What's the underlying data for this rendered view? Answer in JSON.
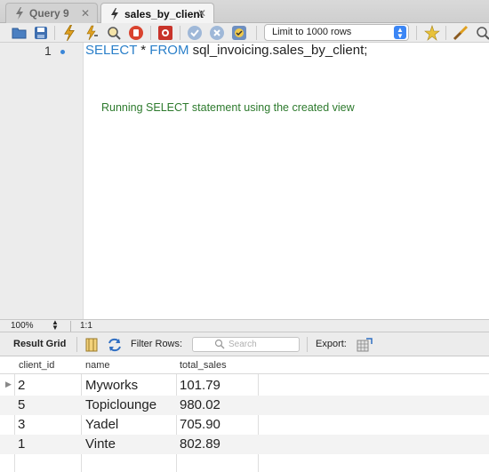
{
  "tabs": [
    {
      "label": "Query 9",
      "active": false
    },
    {
      "label": "sales_by_client",
      "active": true
    }
  ],
  "toolbar": {
    "limit_value": "Limit to 1000 rows"
  },
  "editor": {
    "line_number": "1",
    "code_keyword_select": "SELECT",
    "code_star": " * ",
    "code_keyword_from": "FROM",
    "code_rest": " sql_invoicing.sales_by_client;",
    "annotation": "Running SELECT statement using the created view"
  },
  "statusbar": {
    "zoom": "100%",
    "position": "1:1"
  },
  "results": {
    "label": "Result Grid",
    "filter_label": "Filter Rows:",
    "search_placeholder": "Search",
    "export_label": "Export:",
    "columns": [
      "client_id",
      "name",
      "total_sales"
    ],
    "rows": [
      [
        "2",
        "Myworks",
        "101.79"
      ],
      [
        "5",
        "Topiclounge",
        "980.02"
      ],
      [
        "3",
        "Yadel",
        "705.90"
      ],
      [
        "1",
        "Vinte",
        "802.89"
      ]
    ]
  },
  "colors": {
    "keyword": "#2a7fc9",
    "comment": "#2d7a2d",
    "accent": "#3b86f5"
  }
}
